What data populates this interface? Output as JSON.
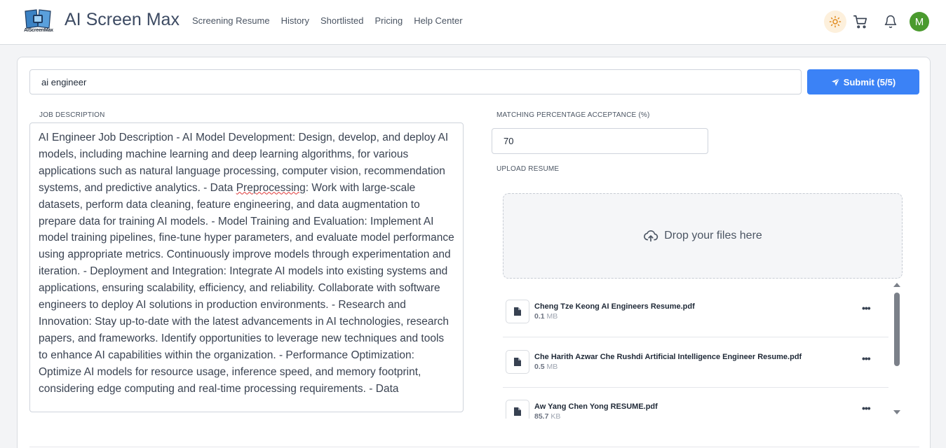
{
  "header": {
    "logo_text": "AIScreenMax",
    "brand": "AI Screen Max",
    "nav": [
      "Screening Resume",
      "History",
      "Shortlisted",
      "Pricing",
      "Help Center"
    ],
    "avatar_initial": "M"
  },
  "search": {
    "value": "ai engineer"
  },
  "submit": {
    "label": "Submit (5/5)"
  },
  "job_description": {
    "label": "JOB DESCRIPTION",
    "text_before": "AI Engineer Job Description - AI Model Development: Design, develop, and deploy AI models, including machine learning and deep learning algorithms, for various applications such as natural language processing, computer vision, recommendation systems, and predictive analytics. - Data ",
    "text_misspelled": "Preprocessing",
    "text_after": ": Work with large-scale datasets, perform data cleaning, feature engineering, and data augmentation to prepare data for training AI models. - Model Training and Evaluation: Implement AI model training pipelines, fine-tune hyper parameters, and evaluate model performance using appropriate metrics. Continuously improve models through experimentation and iteration. - Deployment and Integration: Integrate AI models into existing systems and applications, ensuring scalability, efficiency, and reliability. Collaborate with software engineers to deploy AI solutions in production environments. - Research and Innovation: Stay up-to-date with the latest advancements in AI technologies, research papers, and frameworks. Identify opportunities to leverage new techniques and tools to enhance AI capabilities within the organization. - Performance Optimization: Optimize AI models for resource usage, inference speed, and memory footprint, considering edge computing and real-time processing requirements. - Data"
  },
  "matching": {
    "label": "MATCHING PERCENTAGE ACCEPTANCE (%)",
    "value": "70"
  },
  "upload": {
    "label": "UPLOAD RESUME",
    "dropzone_text": "Drop your files here"
  },
  "files": [
    {
      "name": "Cheng Tze Keong AI Engineers Resume.pdf",
      "size_value": "0.1",
      "size_unit": "MB"
    },
    {
      "name": "Che Harith Azwar Che Rushdi Artificial Intelligence Engineer Resume.pdf",
      "size_value": "0.5",
      "size_unit": "MB"
    },
    {
      "name": "Aw Yang Chen Yong RESUME.pdf",
      "size_value": "85.7",
      "size_unit": "KB"
    }
  ],
  "colors": {
    "accent": "#3b82f6",
    "avatar": "#4a9a2e",
    "sun_bg": "#fdf0dc"
  },
  "icons": [
    "logo-book-icon",
    "sun-icon",
    "cart-icon",
    "bell-icon",
    "paper-plane-icon",
    "upload-cloud-icon",
    "file-icon",
    "more-dots-icon"
  ]
}
